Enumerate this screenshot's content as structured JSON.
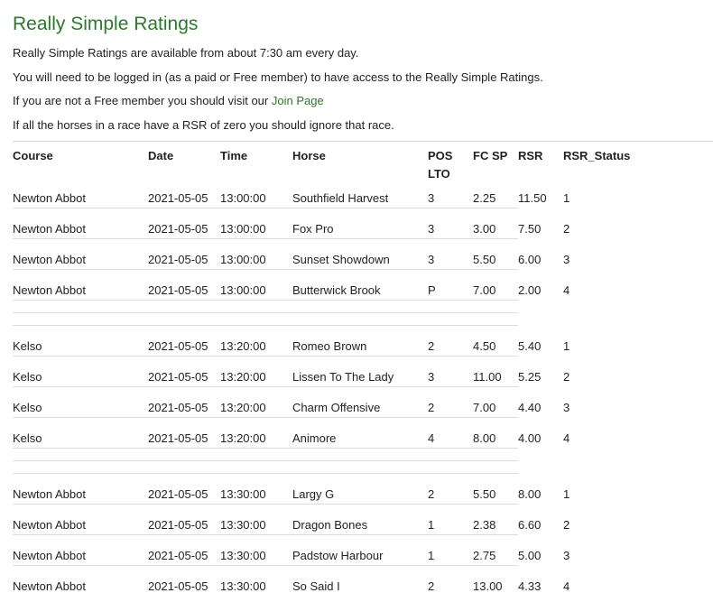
{
  "page": {
    "title": "Really Simple Ratings",
    "line1": "Really Simple Ratings are available from about 7:30 am every day.",
    "line2": "You will need to be logged in (as a paid or Free member) to have access to the Really Simple Ratings.",
    "line3_prefix": "If you are not a Free member you should visit our",
    "line3_link": "Join Page",
    "line4": "If all the horses in a race have a RSR of zero you should ignore that race."
  },
  "table": {
    "headers": {
      "course": "Course",
      "date": "Date",
      "time": "Time",
      "horse": "Horse",
      "pos_line1": "POS",
      "pos_line2": "LTO",
      "fcsp": "FC SP",
      "rsr": "RSR",
      "status": "RSR_Status"
    },
    "rows": [
      {
        "course": "Newton Abbot",
        "date": "2021-05-05",
        "time": "13:00:00",
        "horse": "Southfield Harvest",
        "pos": "3",
        "fcsp": "2.25",
        "rsr": "11.50",
        "status": "1"
      },
      {
        "course": "Newton Abbot",
        "date": "2021-05-05",
        "time": "13:00:00",
        "horse": "Fox Pro",
        "pos": "3",
        "fcsp": "3.00",
        "rsr": "7.50",
        "status": "2"
      },
      {
        "course": "Newton Abbot",
        "date": "2021-05-05",
        "time": "13:00:00",
        "horse": "Sunset Showdown",
        "pos": "3",
        "fcsp": "5.50",
        "rsr": "6.00",
        "status": "3"
      },
      {
        "course": "Newton Abbot",
        "date": "2021-05-05",
        "time": "13:00:00",
        "horse": "Butterwick Brook",
        "pos": "P",
        "fcsp": "7.00",
        "rsr": "2.00",
        "status": "4"
      },
      {
        "course": "Kelso",
        "date": "2021-05-05",
        "time": "13:20:00",
        "horse": "Romeo Brown",
        "pos": "2",
        "fcsp": "4.50",
        "rsr": "5.40",
        "status": "1"
      },
      {
        "course": "Kelso",
        "date": "2021-05-05",
        "time": "13:20:00",
        "horse": "Lissen To The Lady",
        "pos": "3",
        "fcsp": "11.00",
        "rsr": "5.25",
        "status": "2"
      },
      {
        "course": "Kelso",
        "date": "2021-05-05",
        "time": "13:20:00",
        "horse": "Charm Offensive",
        "pos": "2",
        "fcsp": "7.00",
        "rsr": "4.40",
        "status": "3"
      },
      {
        "course": "Kelso",
        "date": "2021-05-05",
        "time": "13:20:00",
        "horse": "Animore",
        "pos": "4",
        "fcsp": "8.00",
        "rsr": "4.00",
        "status": "4"
      },
      {
        "course": "Newton Abbot",
        "date": "2021-05-05",
        "time": "13:30:00",
        "horse": "Largy G",
        "pos": "2",
        "fcsp": "5.50",
        "rsr": "8.00",
        "status": "1"
      },
      {
        "course": "Newton Abbot",
        "date": "2021-05-05",
        "time": "13:30:00",
        "horse": "Dragon Bones",
        "pos": "1",
        "fcsp": "2.38",
        "rsr": "6.60",
        "status": "2"
      },
      {
        "course": "Newton Abbot",
        "date": "2021-05-05",
        "time": "13:30:00",
        "horse": "Padstow Harbour",
        "pos": "1",
        "fcsp": "2.75",
        "rsr": "5.00",
        "status": "3"
      },
      {
        "course": "Newton Abbot",
        "date": "2021-05-05",
        "time": "13:30:00",
        "horse": "So Said I",
        "pos": "2",
        "fcsp": "13.00",
        "rsr": "4.33",
        "status": "4"
      }
    ]
  },
  "colors": {
    "accent": "#2a7a2a",
    "text": "#222222",
    "rule": "#d6d6d6"
  }
}
